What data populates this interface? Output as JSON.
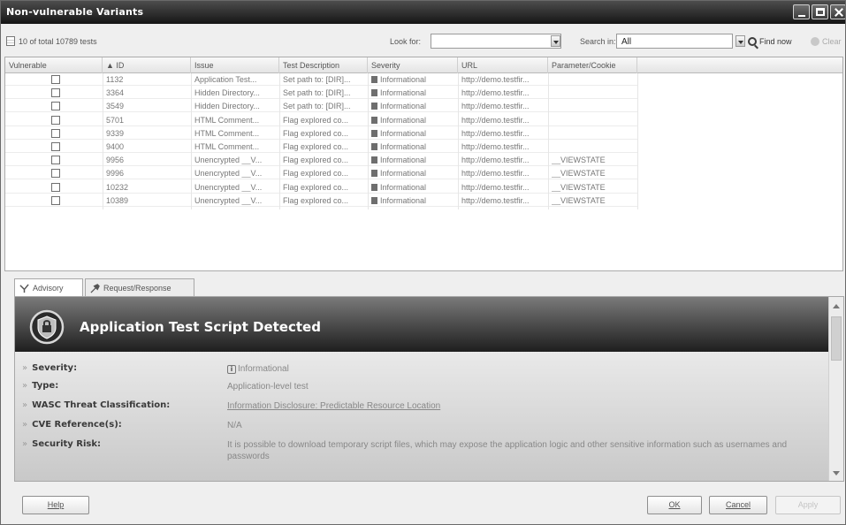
{
  "window": {
    "title": "Non-vulnerable Variants"
  },
  "toolbar": {
    "count_text": "10 of total 10789 tests",
    "look_for_label": "Look for:",
    "look_for_value": "",
    "search_in_label": "Search in:",
    "search_in_value": "All",
    "find_now_label": "Find now",
    "clear_label": "Clear"
  },
  "grid": {
    "columns": [
      "Vulnerable",
      "▲ ID",
      "Issue",
      "Test Description",
      "Severity",
      "URL",
      "Parameter/Cookie"
    ],
    "rows": [
      {
        "id": "1132",
        "issue": "Application Test...",
        "desc": "Set path to: [DIR]...",
        "severity": "Informational",
        "url": "http://demo.testfir...",
        "param": ""
      },
      {
        "id": "3364",
        "issue": "Hidden Directory...",
        "desc": "Set path to: [DIR]...",
        "severity": "Informational",
        "url": "http://demo.testfir...",
        "param": ""
      },
      {
        "id": "3549",
        "issue": "Hidden Directory...",
        "desc": "Set path to: [DIR]...",
        "severity": "Informational",
        "url": "http://demo.testfir...",
        "param": ""
      },
      {
        "id": "5701",
        "issue": "HTML Comment...",
        "desc": "Flag explored co...",
        "severity": "Informational",
        "url": "http://demo.testfir...",
        "param": ""
      },
      {
        "id": "9339",
        "issue": "HTML Comment...",
        "desc": "Flag explored co...",
        "severity": "Informational",
        "url": "http://demo.testfir...",
        "param": ""
      },
      {
        "id": "9400",
        "issue": "HTML Comment...",
        "desc": "Flag explored co...",
        "severity": "Informational",
        "url": "http://demo.testfir...",
        "param": ""
      },
      {
        "id": "9956",
        "issue": "Unencrypted __V...",
        "desc": "Flag explored co...",
        "severity": "Informational",
        "url": "http://demo.testfir...",
        "param": "__VIEWSTATE"
      },
      {
        "id": "9996",
        "issue": "Unencrypted __V...",
        "desc": "Flag explored co...",
        "severity": "Informational",
        "url": "http://demo.testfir...",
        "param": "__VIEWSTATE"
      },
      {
        "id": "10232",
        "issue": "Unencrypted __V...",
        "desc": "Flag explored co...",
        "severity": "Informational",
        "url": "http://demo.testfir...",
        "param": "__VIEWSTATE"
      },
      {
        "id": "10389",
        "issue": "Unencrypted __V...",
        "desc": "Flag explored co...",
        "severity": "Informational",
        "url": "http://demo.testfir...",
        "param": "__VIEWSTATE"
      }
    ]
  },
  "tabs": [
    {
      "label": "Advisory",
      "icon": "advisory-icon"
    },
    {
      "label": "Request/Response",
      "icon": "request-response-icon"
    }
  ],
  "advisory": {
    "title": "Application Test Script Detected",
    "fields": [
      {
        "label": "Severity:",
        "value": "Informational",
        "icon": "info-icon"
      },
      {
        "label": "Type:",
        "value": "Application-level test"
      },
      {
        "label": "WASC Threat Classification:",
        "value": "Information Disclosure: Predictable Resource Location",
        "link": true
      },
      {
        "label": "CVE Reference(s):",
        "value": "N/A"
      },
      {
        "label": "Security Risk:",
        "value": "It is possible to download temporary script files, which may expose the application logic and other sensitive information such as usernames and passwords"
      }
    ]
  },
  "footer": {
    "help": "Help",
    "ok": "OK",
    "cancel": "Cancel",
    "apply": "Apply"
  }
}
